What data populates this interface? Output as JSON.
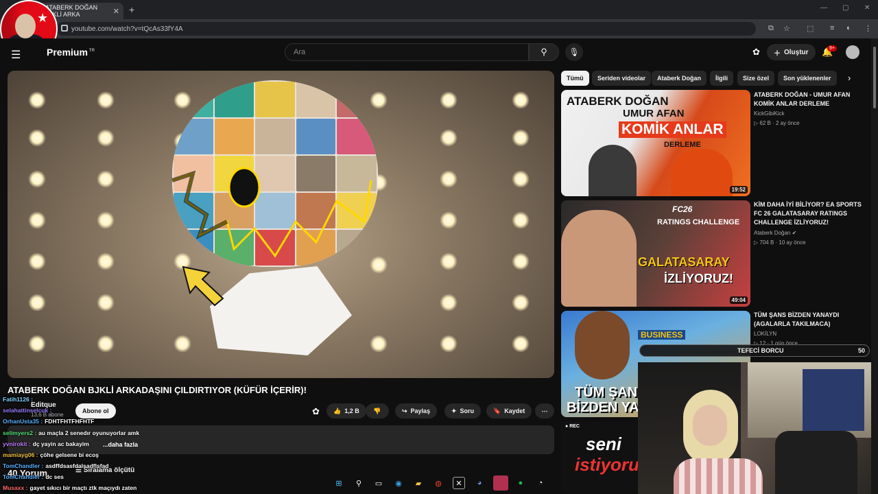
{
  "browser": {
    "tab_title": "ATABERK DOĞAN BJKLİ ARKA",
    "tab_close": "✕",
    "new_tab": "+",
    "url": "youtube.com/watch?v=tQcAs33fY4A"
  },
  "header": {
    "logo": "Premium",
    "logo_tr": "TR",
    "search_placeholder": "Ara",
    "create_label": "Oluştur",
    "notif_count": "9+"
  },
  "video": {
    "title": "ATABERK DOĞAN BJKLİ ARKADAŞINI ÇILDIRTIYOR (KÜFÜR İÇERİR)!",
    "channel": "Editque",
    "subscribers": "13,6 B abone",
    "subscribe_label": "Abone ol",
    "likes": "1,2 B",
    "share_label": "Paylaş",
    "ask_label": "Soru",
    "save_label": "Kaydet",
    "more_label": "...daha fazla",
    "comments_count": "40 Yorum",
    "sort_label": "Sıralama ölçütü"
  },
  "chat": [
    {
      "user": "Fatih1126 :",
      "msg": "",
      "color": "#7fd4ff"
    },
    {
      "user": "selahattinselcuk :",
      "msg": "",
      "color": "#9b7cff"
    },
    {
      "user": "OrhanUsta35 :",
      "msg": "FDHTFHTFHFHTF",
      "color": "#59b0ff"
    },
    {
      "user": "selimyers2 :",
      "msg": "au maçla 2 senedır oyunuyorlar amk",
      "color": "#58e07a"
    },
    {
      "user": "yvnirokit :",
      "msg": "dç yayin ac bakayim",
      "color": "#c27cff"
    },
    {
      "user": "mamiayg06 :",
      "msg": "çöhe gelsene bi ecoş",
      "color": "#f0c040"
    },
    {
      "user": "TomChandler :",
      "msg": "asdffdsasfdalsadflsfad",
      "color": "#59b0ff"
    },
    {
      "user": "TomChandler :",
      "msg": "dc ses",
      "color": "#59b0ff"
    },
    {
      "user": "Musaxx :",
      "msg": "gayet sıkıcı bir maçtı ztk maçıydı zaten",
      "color": "#ff6b6b"
    }
  ],
  "chips": [
    "Tümü",
    "Seriden videolar",
    "Ataberk Doğan",
    "İlgili",
    "Size özel",
    "Son yüklenenler"
  ],
  "recommendations": [
    {
      "title": "ATABERK DOĞAN - UMUR AFAN KOMİK ANLAR DERLEME",
      "channel": "KickGibiKick",
      "meta": "▷ 62 B · 2 ay önce",
      "duration": "19:52",
      "thumb_text1": "ATABERK DOĞAN",
      "thumb_text2": "UMUR AFAN",
      "thumb_text3": "KOMİK ANLAR",
      "thumb_text4": "DERLEME"
    },
    {
      "title": "KİM DAHA İYİ BİLİYOR? EA SPORTS FC 26 GALATASARAY RATINGS CHALLENGE İZLİYORUZ!",
      "channel": "Ataberk Doğan ✔",
      "meta": "▷ 704 B · 10 ay önce",
      "duration": "49:04",
      "thumb_text1": "FC26",
      "thumb_text2": "RATINGS CHALLENGE",
      "thumb_text3": "GALATASARAY",
      "thumb_text4": "İZLİYORUZ!"
    },
    {
      "title": "TÜM ŞANS BİZDEN YANAYDI (AGALARLA TAKILMACA)",
      "channel": "LOKİLYN",
      "meta": "▷ 12 · 1 gün önce",
      "thumb_text1": "BUSINESS",
      "thumb_text2": "TÜM ŞANS",
      "thumb_text3": "BİZDEN YANA"
    },
    {
      "rec_label": "REC",
      "thumb_text1": "seni",
      "thumb_text2": "istiyoru"
    }
  ],
  "overlay": {
    "tefeci_label": "TEFECİ BORCU",
    "tefeci_value": "50"
  },
  "colors": {
    "bg": "#0f0f0f",
    "surface": "#272727",
    "accent_red": "#cc0000"
  }
}
